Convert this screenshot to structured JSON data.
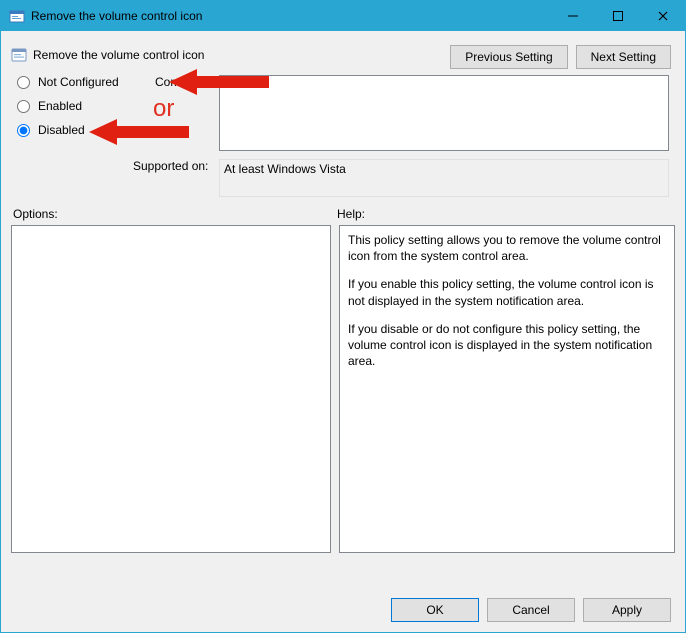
{
  "window": {
    "title": "Remove the volume control icon"
  },
  "header": {
    "policy_title": "Remove the volume control icon",
    "previous_button": "Previous Setting",
    "next_button": "Next Setting"
  },
  "radios": {
    "not_configured": "Not Configured",
    "enabled": "Enabled",
    "disabled": "Disabled",
    "selected": "disabled"
  },
  "comment": {
    "label": "Comment:",
    "value": ""
  },
  "supported": {
    "label": "Supported on:",
    "value": "At least Windows Vista"
  },
  "labels": {
    "options": "Options:",
    "help": "Help:"
  },
  "help": {
    "p1": "This policy setting allows you to remove the volume control icon from the system control area.",
    "p2": "If you enable this policy setting, the volume control icon is not displayed in the system notification area.",
    "p3": "If you disable or do not configure this policy setting, the volume control icon is displayed in the system notification area."
  },
  "footer": {
    "ok": "OK",
    "cancel": "Cancel",
    "apply": "Apply"
  },
  "annotation": {
    "or": "or"
  }
}
